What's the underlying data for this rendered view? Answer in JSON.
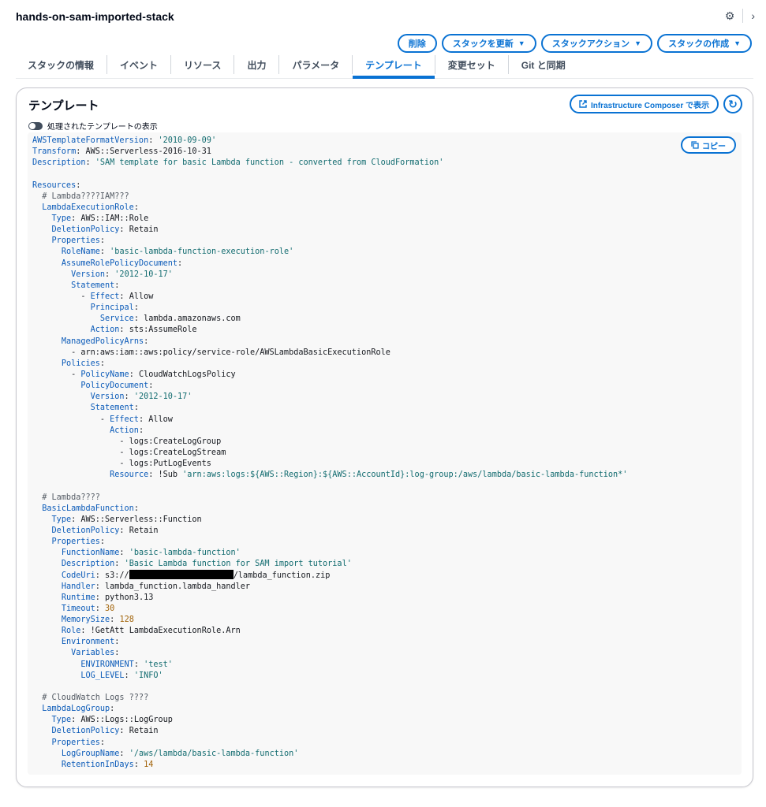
{
  "header": {
    "stack_name": "hands-on-sam-imported-stack",
    "settings_icon": "gear-icon",
    "next_icon": "chevron-right-icon"
  },
  "actions": {
    "delete": "削除",
    "update": "スタックを更新",
    "stack_actions": "スタックアクション",
    "create": "スタックの作成"
  },
  "tabs": [
    "スタックの情報",
    "イベント",
    "リソース",
    "出力",
    "パラメータ",
    "テンプレート",
    "変更セット",
    "Git と同期"
  ],
  "active_tab": "テンプレート",
  "panel": {
    "title": "テンプレート",
    "composer_button": "Infrastructure Composer で表示",
    "toggle_label": "処理されたテンプレートの表示",
    "copy_button": "コピー"
  },
  "template_lines": [
    [
      [
        "k",
        "AWSTemplateFormatVersion"
      ],
      [
        "p",
        ": "
      ],
      [
        "s",
        "'2010-09-09'"
      ]
    ],
    [
      [
        "k",
        "Transform"
      ],
      [
        "p",
        ": AWS::Serverless-2016-10-31"
      ]
    ],
    [
      [
        "k",
        "Description"
      ],
      [
        "p",
        ": "
      ],
      [
        "s",
        "'SAM template for basic Lambda function - converted from CloudFormation'"
      ]
    ],
    [],
    [
      [
        "k",
        "Resources"
      ],
      [
        "p",
        ":"
      ]
    ],
    [
      [
        "c",
        "  # Lambda????IAM???"
      ]
    ],
    [
      [
        "p",
        "  "
      ],
      [
        "k",
        "LambdaExecutionRole"
      ],
      [
        "p",
        ":"
      ]
    ],
    [
      [
        "p",
        "    "
      ],
      [
        "k",
        "Type"
      ],
      [
        "p",
        ": AWS::IAM::Role"
      ]
    ],
    [
      [
        "p",
        "    "
      ],
      [
        "k",
        "DeletionPolicy"
      ],
      [
        "p",
        ": Retain"
      ]
    ],
    [
      [
        "p",
        "    "
      ],
      [
        "k",
        "Properties"
      ],
      [
        "p",
        ":"
      ]
    ],
    [
      [
        "p",
        "      "
      ],
      [
        "k",
        "RoleName"
      ],
      [
        "p",
        ": "
      ],
      [
        "s",
        "'basic-lambda-function-execution-role'"
      ]
    ],
    [
      [
        "p",
        "      "
      ],
      [
        "k",
        "AssumeRolePolicyDocument"
      ],
      [
        "p",
        ":"
      ]
    ],
    [
      [
        "p",
        "        "
      ],
      [
        "k",
        "Version"
      ],
      [
        "p",
        ": "
      ],
      [
        "s",
        "'2012-10-17'"
      ]
    ],
    [
      [
        "p",
        "        "
      ],
      [
        "k",
        "Statement"
      ],
      [
        "p",
        ":"
      ]
    ],
    [
      [
        "p",
        "          - "
      ],
      [
        "k",
        "Effect"
      ],
      [
        "p",
        ": Allow"
      ]
    ],
    [
      [
        "p",
        "            "
      ],
      [
        "k",
        "Principal"
      ],
      [
        "p",
        ":"
      ]
    ],
    [
      [
        "p",
        "              "
      ],
      [
        "k",
        "Service"
      ],
      [
        "p",
        ": lambda.amazonaws.com"
      ]
    ],
    [
      [
        "p",
        "            "
      ],
      [
        "k",
        "Action"
      ],
      [
        "p",
        ": sts:AssumeRole"
      ]
    ],
    [
      [
        "p",
        "      "
      ],
      [
        "k",
        "ManagedPolicyArns"
      ],
      [
        "p",
        ":"
      ]
    ],
    [
      [
        "p",
        "        - arn:aws:iam::aws:policy/service-role/AWSLambdaBasicExecutionRole"
      ]
    ],
    [
      [
        "p",
        "      "
      ],
      [
        "k",
        "Policies"
      ],
      [
        "p",
        ":"
      ]
    ],
    [
      [
        "p",
        "        - "
      ],
      [
        "k",
        "PolicyName"
      ],
      [
        "p",
        ": CloudWatchLogsPolicy"
      ]
    ],
    [
      [
        "p",
        "          "
      ],
      [
        "k",
        "PolicyDocument"
      ],
      [
        "p",
        ":"
      ]
    ],
    [
      [
        "p",
        "            "
      ],
      [
        "k",
        "Version"
      ],
      [
        "p",
        ": "
      ],
      [
        "s",
        "'2012-10-17'"
      ]
    ],
    [
      [
        "p",
        "            "
      ],
      [
        "k",
        "Statement"
      ],
      [
        "p",
        ":"
      ]
    ],
    [
      [
        "p",
        "              - "
      ],
      [
        "k",
        "Effect"
      ],
      [
        "p",
        ": Allow"
      ]
    ],
    [
      [
        "p",
        "                "
      ],
      [
        "k",
        "Action"
      ],
      [
        "p",
        ":"
      ]
    ],
    [
      [
        "p",
        "                  - logs:CreateLogGroup"
      ]
    ],
    [
      [
        "p",
        "                  - logs:CreateLogStream"
      ]
    ],
    [
      [
        "p",
        "                  - logs:PutLogEvents"
      ]
    ],
    [
      [
        "p",
        "                "
      ],
      [
        "k",
        "Resource"
      ],
      [
        "p",
        ": !Sub "
      ],
      [
        "s",
        "'arn:aws:logs:${AWS::Region}:${AWS::AccountId}:log-group:/aws/lambda/basic-lambda-function*'"
      ]
    ],
    [],
    [
      [
        "c",
        "  # Lambda????"
      ]
    ],
    [
      [
        "p",
        "  "
      ],
      [
        "k",
        "BasicLambdaFunction"
      ],
      [
        "p",
        ":"
      ]
    ],
    [
      [
        "p",
        "    "
      ],
      [
        "k",
        "Type"
      ],
      [
        "p",
        ": AWS::Serverless::Function"
      ]
    ],
    [
      [
        "p",
        "    "
      ],
      [
        "k",
        "DeletionPolicy"
      ],
      [
        "p",
        ": Retain"
      ]
    ],
    [
      [
        "p",
        "    "
      ],
      [
        "k",
        "Properties"
      ],
      [
        "p",
        ":"
      ]
    ],
    [
      [
        "p",
        "      "
      ],
      [
        "k",
        "FunctionName"
      ],
      [
        "p",
        ": "
      ],
      [
        "s",
        "'basic-lambda-function'"
      ]
    ],
    [
      [
        "p",
        "      "
      ],
      [
        "k",
        "Description"
      ],
      [
        "p",
        ": "
      ],
      [
        "s",
        "'Basic Lambda function for SAM import tutorial'"
      ]
    ],
    [
      [
        "p",
        "      "
      ],
      [
        "k",
        "CodeUri"
      ],
      [
        "p",
        ": s3://"
      ],
      [
        "r",
        ""
      ],
      [
        "p",
        "/lambda_function.zip"
      ]
    ],
    [
      [
        "p",
        "      "
      ],
      [
        "k",
        "Handler"
      ],
      [
        "p",
        ": lambda_function.lambda_handler"
      ]
    ],
    [
      [
        "p",
        "      "
      ],
      [
        "k",
        "Runtime"
      ],
      [
        "p",
        ": python3.13"
      ]
    ],
    [
      [
        "p",
        "      "
      ],
      [
        "k",
        "Timeout"
      ],
      [
        "p",
        ": "
      ],
      [
        "n",
        "30"
      ]
    ],
    [
      [
        "p",
        "      "
      ],
      [
        "k",
        "MemorySize"
      ],
      [
        "p",
        ": "
      ],
      [
        "n",
        "128"
      ]
    ],
    [
      [
        "p",
        "      "
      ],
      [
        "k",
        "Role"
      ],
      [
        "p",
        ": !GetAtt LambdaExecutionRole.Arn"
      ]
    ],
    [
      [
        "p",
        "      "
      ],
      [
        "k",
        "Environment"
      ],
      [
        "p",
        ":"
      ]
    ],
    [
      [
        "p",
        "        "
      ],
      [
        "k",
        "Variables"
      ],
      [
        "p",
        ":"
      ]
    ],
    [
      [
        "p",
        "          "
      ],
      [
        "k",
        "ENVIRONMENT"
      ],
      [
        "p",
        ": "
      ],
      [
        "s",
        "'test'"
      ]
    ],
    [
      [
        "p",
        "          "
      ],
      [
        "k",
        "LOG_LEVEL"
      ],
      [
        "p",
        ": "
      ],
      [
        "s",
        "'INFO'"
      ]
    ],
    [],
    [
      [
        "c",
        "  # CloudWatch Logs ????"
      ]
    ],
    [
      [
        "p",
        "  "
      ],
      [
        "k",
        "LambdaLogGroup"
      ],
      [
        "p",
        ":"
      ]
    ],
    [
      [
        "p",
        "    "
      ],
      [
        "k",
        "Type"
      ],
      [
        "p",
        ": AWS::Logs::LogGroup"
      ]
    ],
    [
      [
        "p",
        "    "
      ],
      [
        "k",
        "DeletionPolicy"
      ],
      [
        "p",
        ": Retain"
      ]
    ],
    [
      [
        "p",
        "    "
      ],
      [
        "k",
        "Properties"
      ],
      [
        "p",
        ":"
      ]
    ],
    [
      [
        "p",
        "      "
      ],
      [
        "k",
        "LogGroupName"
      ],
      [
        "p",
        ": "
      ],
      [
        "s",
        "'/aws/lambda/basic-lambda-function'"
      ]
    ],
    [
      [
        "p",
        "      "
      ],
      [
        "k",
        "RetentionInDays"
      ],
      [
        "p",
        ": "
      ],
      [
        "n",
        "14"
      ]
    ]
  ]
}
